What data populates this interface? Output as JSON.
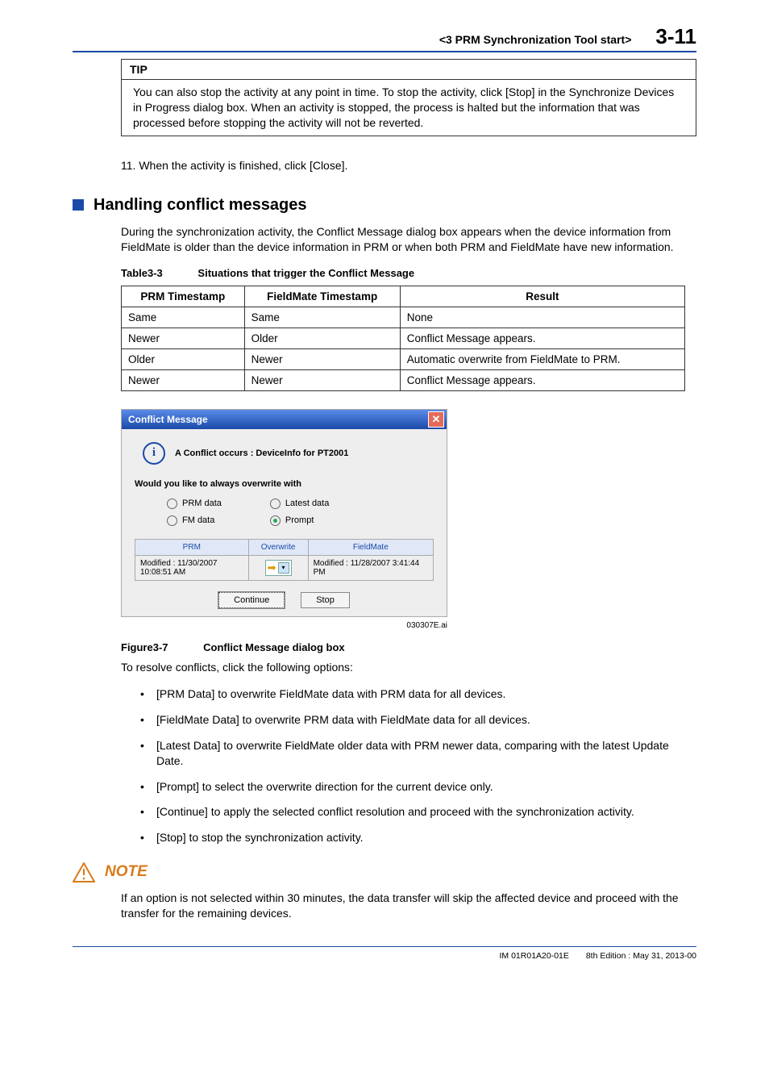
{
  "header": {
    "title": "<3  PRM Synchronization Tool start>",
    "page": "3-11"
  },
  "tip": {
    "label": "TIP",
    "body": "You can also stop the activity at any point in time. To stop the activity, click [Stop] in the Synchronize Devices in Progress dialog box. When an activity is stopped, the process is halted but the information that was processed before stopping the activity will not be reverted."
  },
  "step11": "11.   When the activity is finished, click [Close].",
  "h2": "Handling conflict messages",
  "intro": "During the synchronization activity, the Conflict Message dialog box appears when the device information from FieldMate is older than the device information in PRM or when both PRM and FieldMate have new information.",
  "table_caption": {
    "label": "Table3-3",
    "title": "Situations that trigger the Conflict Message"
  },
  "table": {
    "headers": [
      "PRM Timestamp",
      "FieldMate Timestamp",
      "Result"
    ],
    "rows": [
      [
        "Same",
        "Same",
        "None"
      ],
      [
        "Newer",
        "Older",
        "Conflict Message appears."
      ],
      [
        "Older",
        "Newer",
        "Automatic overwrite from FieldMate to PRM."
      ],
      [
        "Newer",
        "Newer",
        "Conflict Message appears."
      ]
    ]
  },
  "dialog": {
    "title": "Conflict Message",
    "conflict_text": "A Conflict occurs :   DeviceInfo for PT2001",
    "question": "Would you like to always overwrite with",
    "opts": {
      "prm": "PRM data",
      "fm": "FM data",
      "latest": "Latest data",
      "prompt": "Prompt"
    },
    "cols": {
      "prm": "PRM",
      "ow": "Overwrite",
      "fm": "FieldMate"
    },
    "mod_prm": "Modified : 11/30/2007 10:08:51 AM",
    "mod_fm": "Modified : 11/28/2007 3:41:44 PM",
    "btn_continue": "Continue",
    "btn_stop": "Stop"
  },
  "fig_ref": "030307E.ai",
  "fig_caption": {
    "label": "Figure3-7",
    "title": "Conflict Message dialog box"
  },
  "resolve_intro": "To resolve conflicts, click the following options:",
  "bullets": [
    "[PRM Data] to overwrite FieldMate data with PRM data for all devices.",
    "[FieldMate Data] to overwrite PRM data with FieldMate data for all devices.",
    "[Latest Data] to overwrite FieldMate older data with PRM newer data, comparing with the latest Update Date.",
    "[Prompt] to select the overwrite direction for the current device only.",
    "[Continue] to apply the selected conflict resolution and proceed with the synchronization activity.",
    "[Stop] to stop the synchronization activity."
  ],
  "note": {
    "label": "NOTE",
    "body": "If an option is not selected within 30 minutes, the data transfer will skip the affected device and proceed with the transfer for the remaining devices."
  },
  "footer": {
    "doc": "IM 01R01A20-01E",
    "edition": "8th Edition : May 31, 2013-00"
  }
}
